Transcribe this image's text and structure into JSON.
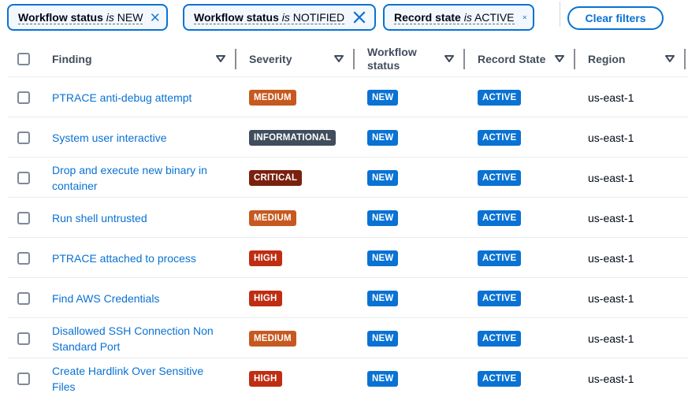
{
  "filters": [
    {
      "property": "Workflow status",
      "operator": "is",
      "value": "NEW"
    },
    {
      "property": "Workflow status",
      "operator": "is",
      "value": "NOTIFIED"
    },
    {
      "property": "Record state",
      "operator": "is",
      "value": "ACTIVE"
    }
  ],
  "clear_filters_label": "Clear filters",
  "columns": {
    "finding": "Finding",
    "severity": "Severity",
    "workflow_status_line1": "Workflow",
    "workflow_status_line2": "status",
    "record_state": "Record State",
    "region": "Region"
  },
  "rows": [
    {
      "finding": "PTRACE anti-debug attempt",
      "finding2": "",
      "severity": "MEDIUM",
      "workflow": "NEW",
      "record": "ACTIVE",
      "region": "us-east-1"
    },
    {
      "finding": "System user interactive",
      "finding2": "",
      "severity": "INFORMATIONAL",
      "workflow": "NEW",
      "record": "ACTIVE",
      "region": "us-east-1"
    },
    {
      "finding": "Drop and execute new binary in",
      "finding2": "container",
      "severity": "CRITICAL",
      "workflow": "NEW",
      "record": "ACTIVE",
      "region": "us-east-1"
    },
    {
      "finding": "Run shell untrusted",
      "finding2": "",
      "severity": "MEDIUM",
      "workflow": "NEW",
      "record": "ACTIVE",
      "region": "us-east-1"
    },
    {
      "finding": "PTRACE attached to process",
      "finding2": "",
      "severity": "HIGH",
      "workflow": "NEW",
      "record": "ACTIVE",
      "region": "us-east-1"
    },
    {
      "finding": "Find AWS Credentials",
      "finding2": "",
      "severity": "HIGH",
      "workflow": "NEW",
      "record": "ACTIVE",
      "region": "us-east-1"
    },
    {
      "finding": "Disallowed SSH Connection Non",
      "finding2": "Standard Port",
      "severity": "MEDIUM",
      "workflow": "NEW",
      "record": "ACTIVE",
      "region": "us-east-1"
    },
    {
      "finding": "Create Hardlink Over Sensitive",
      "finding2": "Files",
      "severity": "HIGH",
      "workflow": "NEW",
      "record": "ACTIVE",
      "region": "us-east-1"
    }
  ],
  "colors": {
    "accent": "#0972d3",
    "MEDIUM": "#c6591f",
    "INFORMATIONAL": "#414d5c",
    "CRITICAL": "#7a200f",
    "HIGH": "#bf2d12",
    "NEW": "#0972d3",
    "ACTIVE": "#0972d3"
  },
  "icons": {
    "token_close": "close-icon",
    "column_sort": "caret-down-icon",
    "select": "checkbox-icon"
  }
}
